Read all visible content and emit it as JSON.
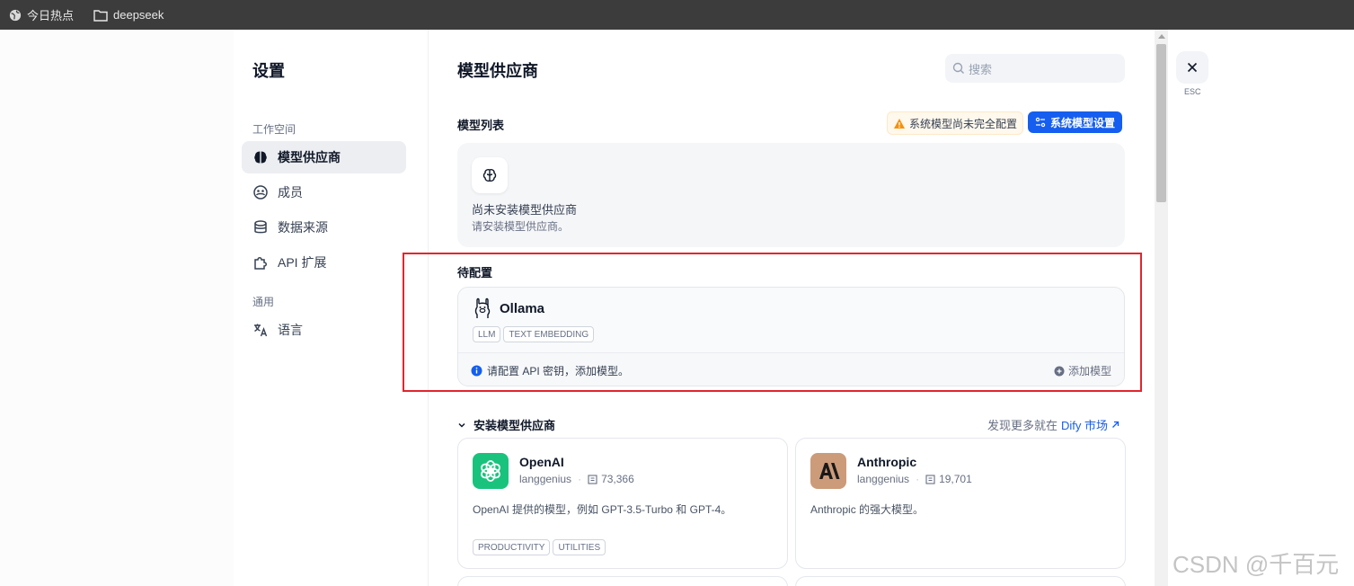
{
  "bookmarks": [
    {
      "label": "今日热点",
      "icon": "globe-icon"
    },
    {
      "label": "deepseek",
      "icon": "folder-icon"
    }
  ],
  "sidebar": {
    "title": "设置",
    "workspace_label": "工作空间",
    "general_label": "通用",
    "items": [
      {
        "label": "模型供应商",
        "icon": "brain-icon",
        "active": true
      },
      {
        "label": "成员",
        "icon": "members-icon"
      },
      {
        "label": "数据来源",
        "icon": "database-icon"
      },
      {
        "label": "API 扩展",
        "icon": "puzzle-icon"
      },
      {
        "label": "语言",
        "icon": "translate-icon"
      }
    ]
  },
  "main": {
    "title": "模型供应商",
    "search_placeholder": "搜索",
    "model_list_label": "模型列表",
    "warning_text": "系统模型尚未完全配置",
    "system_settings_button": "系统模型设置",
    "empty": {
      "title": "尚未安装模型供应商",
      "subtitle": "请安装模型供应商。"
    },
    "pending_label": "待配置",
    "pending_provider": {
      "name": "Ollama",
      "tags": [
        "LLM",
        "TEXT EMBEDDING"
      ],
      "hint": "请配置 API 密钥，添加模型。",
      "add_label": "添加模型"
    },
    "install_label": "安装模型供应商",
    "market_prefix": "发现更多就在",
    "market_link": "Dify 市场",
    "providers": [
      {
        "name": "OpenAI",
        "author": "langgenius",
        "installs": "73,366",
        "description": "OpenAI 提供的模型，例如 GPT-3.5-Turbo 和 GPT-4。",
        "tags": [
          "PRODUCTIVITY",
          "UTILITIES"
        ],
        "color": "#19c37d"
      },
      {
        "name": "Anthropic",
        "author": "langgenius",
        "installs": "19,701",
        "description": "Anthropic 的强大模型。",
        "tags": [],
        "color": "#cc9b7a"
      }
    ]
  },
  "close": {
    "label": "ESC"
  },
  "watermark": "CSDN @千百元",
  "colors": {
    "accent": "#155eef",
    "annotation": "#e0262e"
  }
}
